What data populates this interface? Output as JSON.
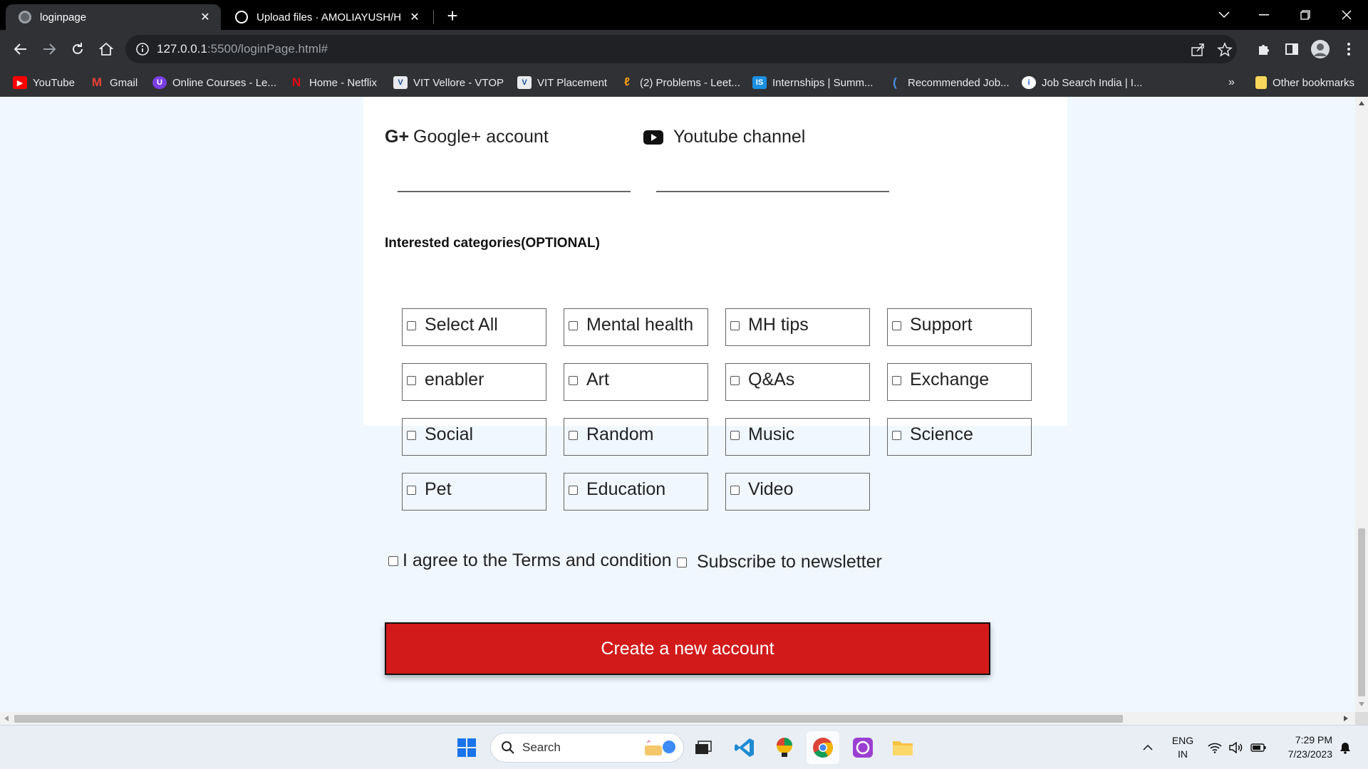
{
  "browser": {
    "tabs": [
      {
        "title": "loginpage",
        "active": true
      },
      {
        "title": "Upload files · AMOLIAYUSH/Habi",
        "active": false
      }
    ],
    "url_host": "127.0.0.1",
    "url_rest": ":5500/loginPage.html#",
    "bookmarks": [
      {
        "label": "YouTube",
        "icon": "youtube-icon"
      },
      {
        "label": "Gmail",
        "icon": "gmail-icon"
      },
      {
        "label": "Online Courses - Le...",
        "icon": "courses-icon"
      },
      {
        "label": "Home - Netflix",
        "icon": "netflix-icon"
      },
      {
        "label": "VIT Vellore - VTOP",
        "icon": "vtop-icon"
      },
      {
        "label": "VIT Placement",
        "icon": "vit-placement-icon"
      },
      {
        "label": "(2) Problems - Leet...",
        "icon": "leetcode-icon"
      },
      {
        "label": "Internships | Summ...",
        "icon": "internshala-icon"
      },
      {
        "label": "Recommended Job...",
        "icon": "naukri-icon"
      },
      {
        "label": "Job Search India | I...",
        "icon": "indeed-icon"
      }
    ],
    "other_bookmarks": "Other bookmarks",
    "overflow": "»"
  },
  "form": {
    "google_label": "Google+ account",
    "youtube_label": "Youtube channel",
    "categories_title": "Interested categories(OPTIONAL)",
    "categories": [
      "Select All",
      "Mental health",
      "MH tips",
      "Support",
      "enabler",
      "Art",
      "Q&As",
      "Exchange",
      "Social",
      "Random",
      "Music",
      "Science",
      "Pet",
      "Education",
      "Video"
    ],
    "terms_label": "I agree to the Terms and condition",
    "newsletter_label": "Subscribe to newsletter",
    "create_button": "Create a new account"
  },
  "taskbar": {
    "search_placeholder": "Search",
    "lang_top": "ENG",
    "lang_bottom": "IN",
    "time": "7:29 PM",
    "date": "7/23/2023"
  },
  "colors": {
    "accent_button": "#d21a1a",
    "page_bg": "#f0f7ff",
    "chrome_dark": "#303134"
  }
}
